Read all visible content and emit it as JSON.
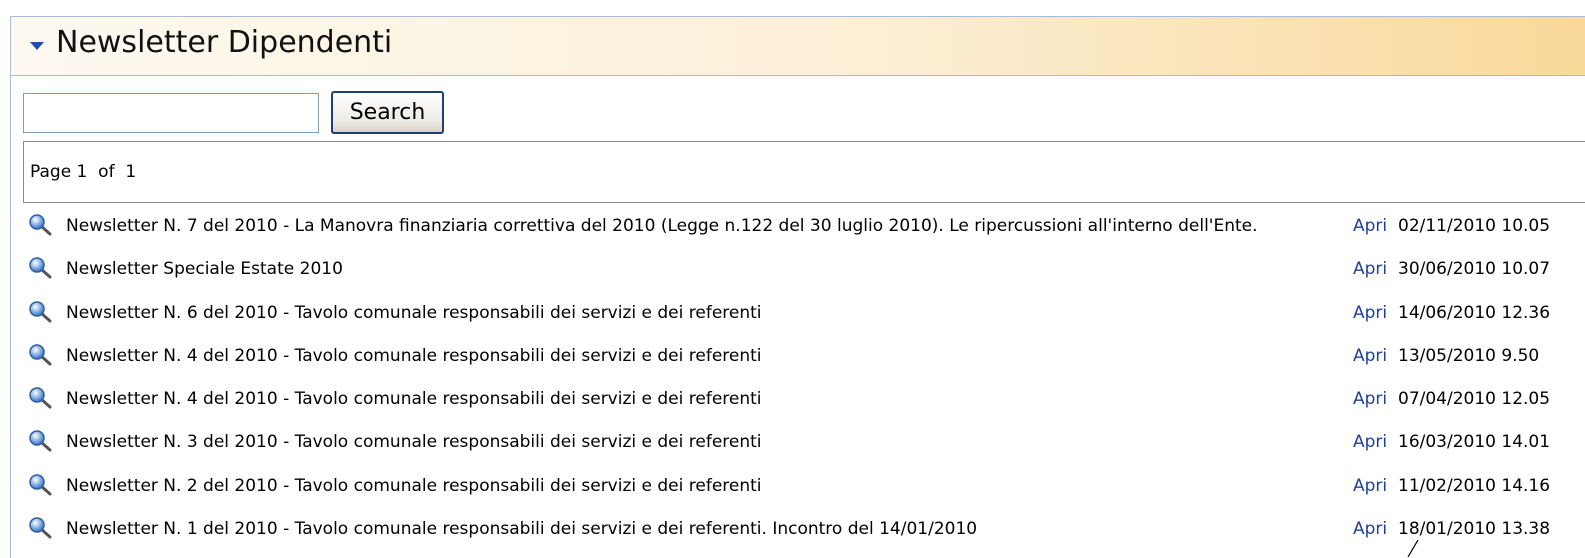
{
  "header": {
    "title": "Newsletter Dipendenti"
  },
  "search": {
    "value": "",
    "button_label": "Search"
  },
  "pager": {
    "text": "Page 1  of  1"
  },
  "items": [
    {
      "title": "Newsletter N. 7 del 2010 - La Manovra finanziaria correttiva del 2010 (Legge n.122 del 30 luglio 2010). Le ripercussioni all'interno dell'Ente.",
      "link": "Apri",
      "date": "02/11/2010 10.05"
    },
    {
      "title": "Newsletter Speciale Estate 2010",
      "link": "Apri",
      "date": "30/06/2010 10.07"
    },
    {
      "title": "Newsletter N. 6 del 2010 - Tavolo comunale responsabili dei servizi e dei referenti",
      "link": "Apri",
      "date": "14/06/2010 12.36"
    },
    {
      "title": "Newsletter N. 4 del 2010 - Tavolo comunale responsabili dei servizi e dei referenti",
      "link": "Apri",
      "date": "13/05/2010 9.50"
    },
    {
      "title": "Newsletter N. 4 del 2010 - Tavolo comunale responsabili dei servizi e dei referenti",
      "link": "Apri",
      "date": "07/04/2010 12.05"
    },
    {
      "title": "Newsletter N. 3 del 2010 - Tavolo comunale responsabili dei servizi e dei referenti",
      "link": "Apri",
      "date": "16/03/2010 14.01"
    },
    {
      "title": "Newsletter N. 2 del 2010 - Tavolo comunale responsabili dei servizi e dei referenti",
      "link": "Apri",
      "date": "11/02/2010 14.16"
    },
    {
      "title": "Newsletter N. 1 del 2010 - Tavolo comunale responsabili dei servizi e dei referenti. Incontro del 14/01/2010",
      "link": "Apri",
      "date": "18/01/2010 13.38"
    }
  ],
  "colors": {
    "link": "#1f3f9c",
    "header_gradient_end": "#f9d89a",
    "border": "#a8bcd8"
  },
  "icons": {
    "collapse": "triangle-down-icon",
    "row": "search-icon"
  }
}
